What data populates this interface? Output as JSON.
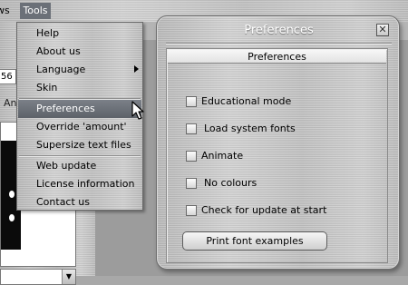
{
  "menubar": {
    "view_label": "ws",
    "tools_label": "Tools"
  },
  "left": {
    "number_value": "56",
    "tab_label": "Ant"
  },
  "tools_menu": {
    "items": [
      {
        "label": "Help"
      },
      {
        "label": "About us"
      },
      {
        "label": "Language",
        "has_submenu": true
      },
      {
        "label": "Skin"
      },
      {
        "label": "Preferences",
        "selected": true
      },
      {
        "label": "Override 'amount'"
      },
      {
        "label": "Supersize text files"
      },
      {
        "label": "Web update"
      },
      {
        "label": "License information"
      },
      {
        "label": "Contact us"
      }
    ]
  },
  "dialog": {
    "title": "Preferences",
    "close_glyph": "✕",
    "group_title": "Preferences",
    "options": [
      {
        "label": "Educational mode",
        "checked": false
      },
      {
        "label": "Load system fonts",
        "checked": false
      },
      {
        "label": "Animate",
        "checked": false
      },
      {
        "label": "No colours",
        "checked": false
      },
      {
        "label": "Check for update at start",
        "checked": false
      }
    ],
    "print_button_label": "Print font examples"
  },
  "colors": {
    "menu_highlight": "#6b7078",
    "dialog_title_text": "#ffffff"
  }
}
